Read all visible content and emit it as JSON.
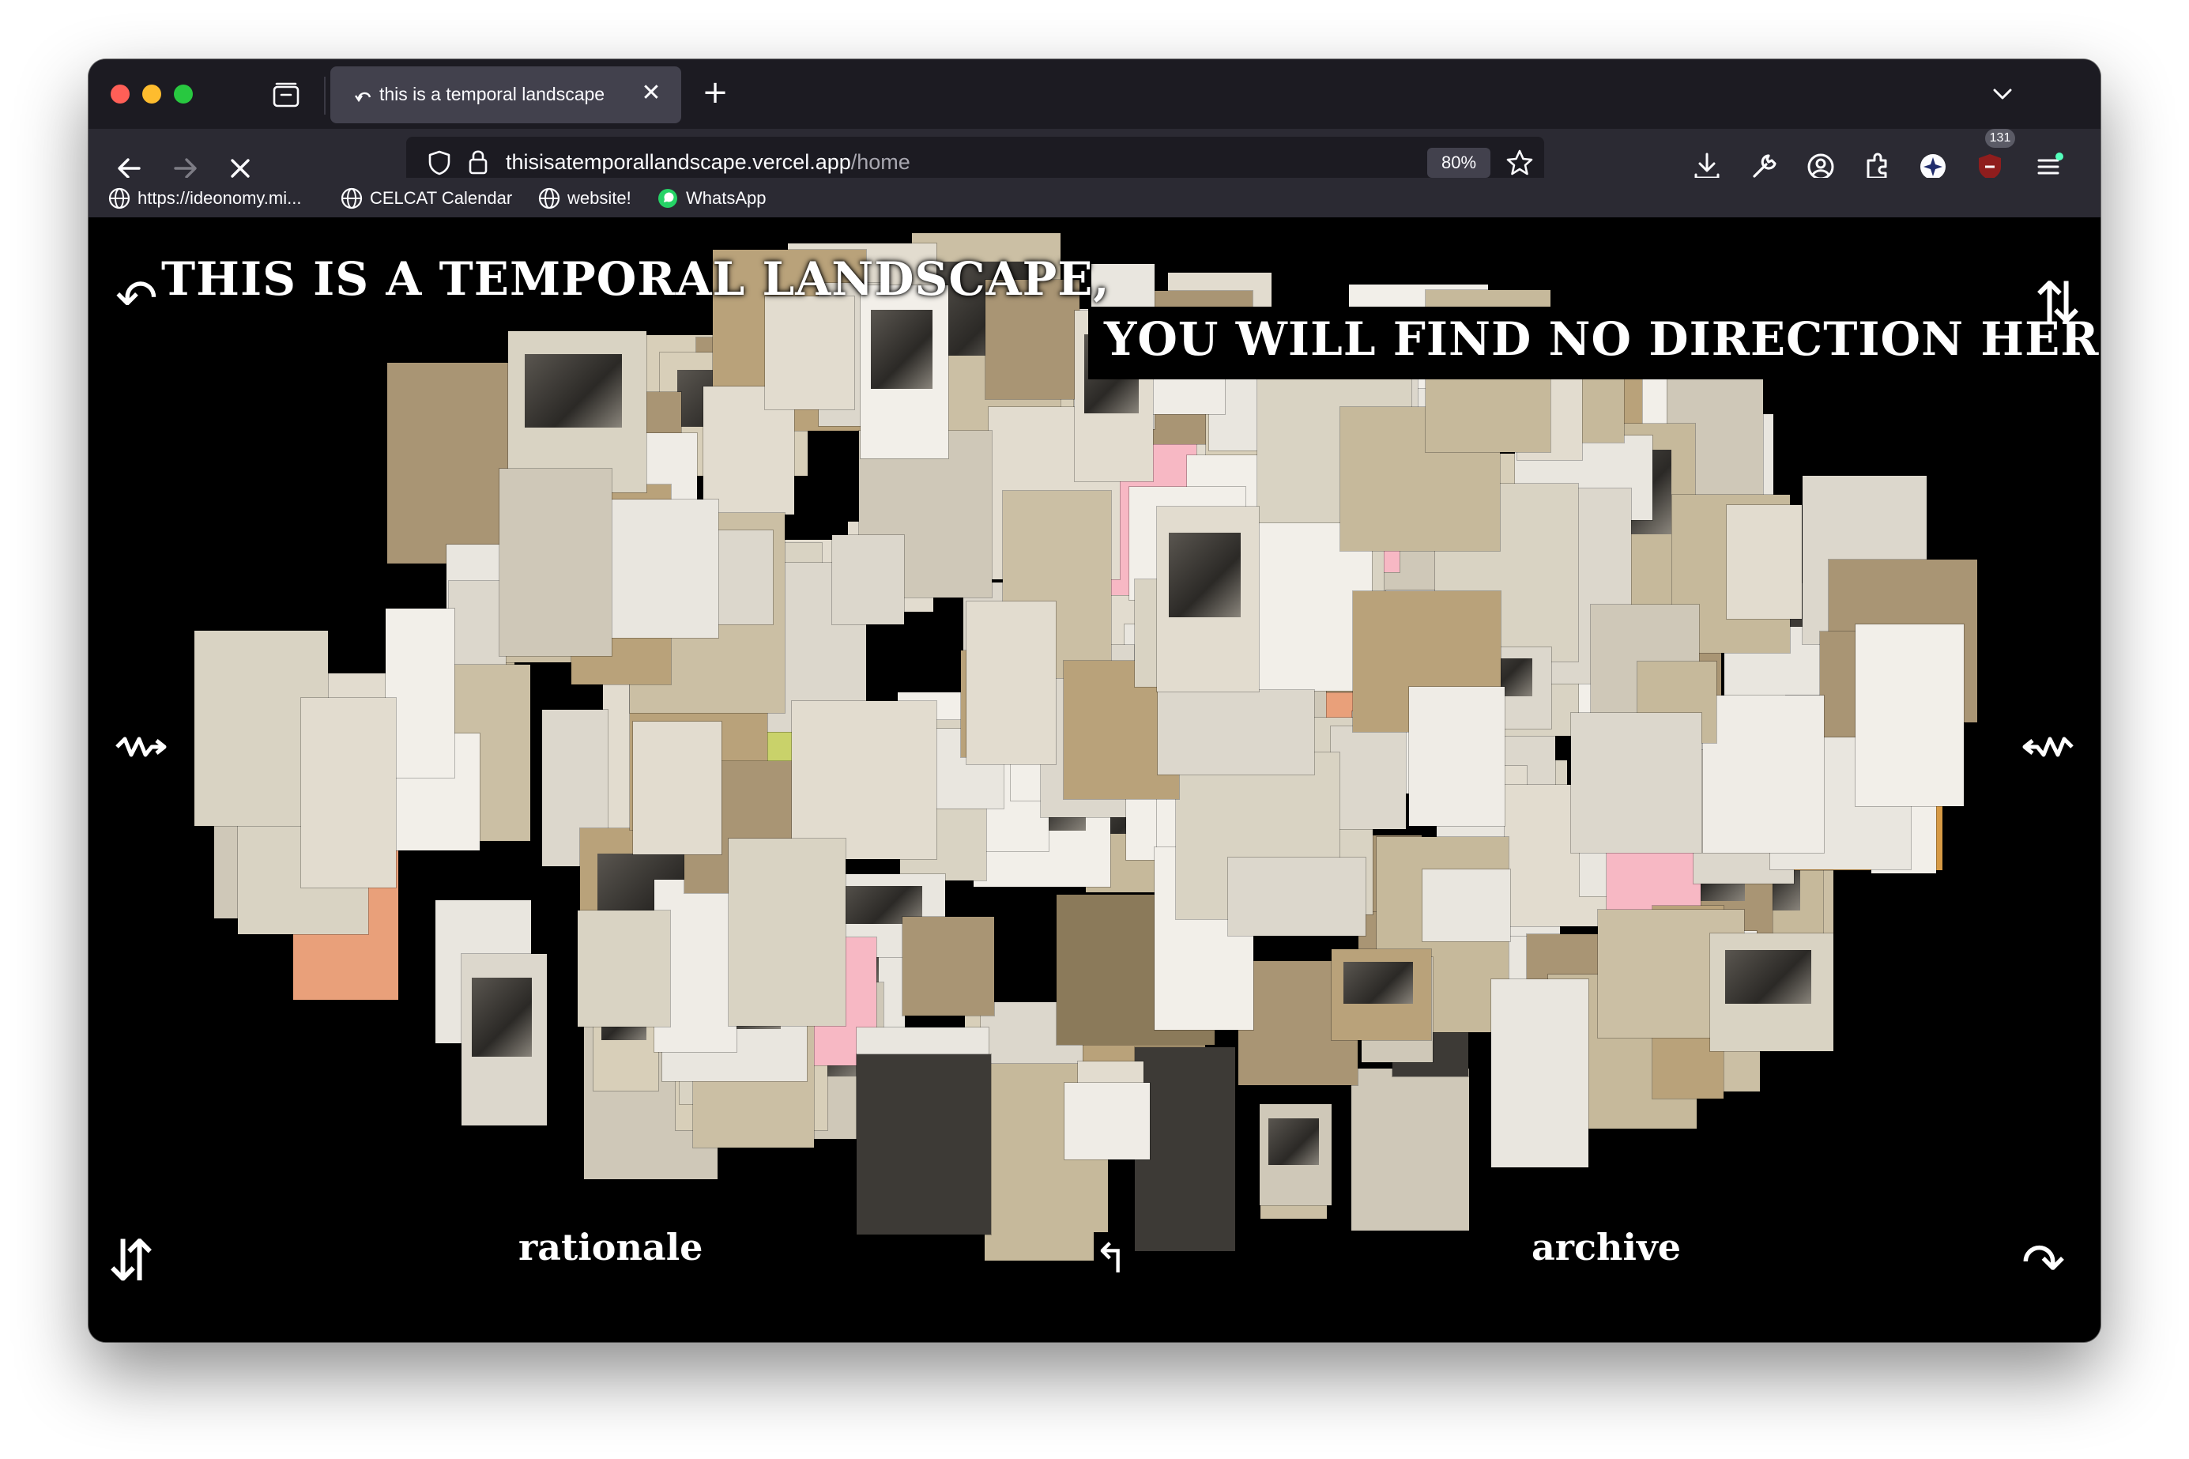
{
  "browser": {
    "tab_title": "this is a temporal landscape",
    "tab_close_glyph": "✕",
    "new_tab_glyph": "+",
    "url_host": "thisisatemporallandscape.vercel.app",
    "url_path": "/home",
    "zoom": "80%",
    "extension_badge": "131"
  },
  "bookmarks": [
    {
      "label": "https://ideonomy.mi..."
    },
    {
      "label": "CELCAT Calendar"
    },
    {
      "label": "website!"
    },
    {
      "label": "WhatsApp"
    }
  ],
  "page": {
    "title_line1": "THIS IS A TEMPORAL LANDSCAPE,",
    "title_line2": "YOU WILL FIND NO DIRECTION HERE",
    "arrow_top_left": "↶",
    "arrow_top_right": "⇅",
    "arrow_bottom_left": "⇵",
    "arrow_bottom_right": "↷",
    "arrow_center_bottom": "↰",
    "link_rationale": "rationale",
    "link_archive": "archive"
  },
  "colors": {
    "page_background": "#000000",
    "text": "#ffffff",
    "toolbar": "#2b2a33",
    "tabstrip": "#1c1b22",
    "active_tab": "#42414d"
  }
}
